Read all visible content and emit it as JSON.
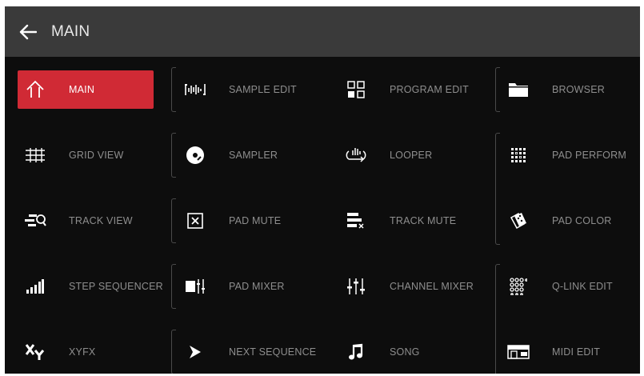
{
  "header": {
    "title": "MAIN",
    "back_icon": "arrow-left-icon"
  },
  "colors": {
    "active": "#d02a35",
    "background": "#0d0d0d",
    "header": "#3a3a3a",
    "label": "#8e8e8e"
  },
  "menu": [
    {
      "label": "MAIN",
      "icon": "home-icon",
      "active": true
    },
    {
      "label": "SAMPLE EDIT",
      "icon": "waveform-icon"
    },
    {
      "label": "PROGRAM EDIT",
      "icon": "program-grid-icon"
    },
    {
      "label": "BROWSER",
      "icon": "folder-icon"
    },
    {
      "label": "GRID VIEW",
      "icon": "grid-view-icon"
    },
    {
      "label": "SAMPLER",
      "icon": "sampler-disc-icon"
    },
    {
      "label": "LOOPER",
      "icon": "looper-icon"
    },
    {
      "label": "PAD PERFORM",
      "icon": "pad-perform-icon"
    },
    {
      "label": "TRACK VIEW",
      "icon": "track-view-icon"
    },
    {
      "label": "PAD MUTE",
      "icon": "pad-mute-icon"
    },
    {
      "label": "TRACK MUTE",
      "icon": "track-mute-icon"
    },
    {
      "label": "PAD COLOR",
      "icon": "pad-color-icon"
    },
    {
      "label": "STEP SEQUENCER",
      "icon": "step-sequencer-icon"
    },
    {
      "label": "PAD MIXER",
      "icon": "pad-mixer-icon"
    },
    {
      "label": "CHANNEL MIXER",
      "icon": "channel-mixer-icon"
    },
    {
      "label": "Q-LINK EDIT",
      "icon": "q-link-icon"
    },
    {
      "label": "XYFX",
      "icon": "xyfx-icon"
    },
    {
      "label": "NEXT SEQUENCE",
      "icon": "next-sequence-icon"
    },
    {
      "label": "SONG",
      "icon": "music-note-icon"
    },
    {
      "label": "MIDI EDIT",
      "icon": "midi-edit-icon"
    }
  ]
}
